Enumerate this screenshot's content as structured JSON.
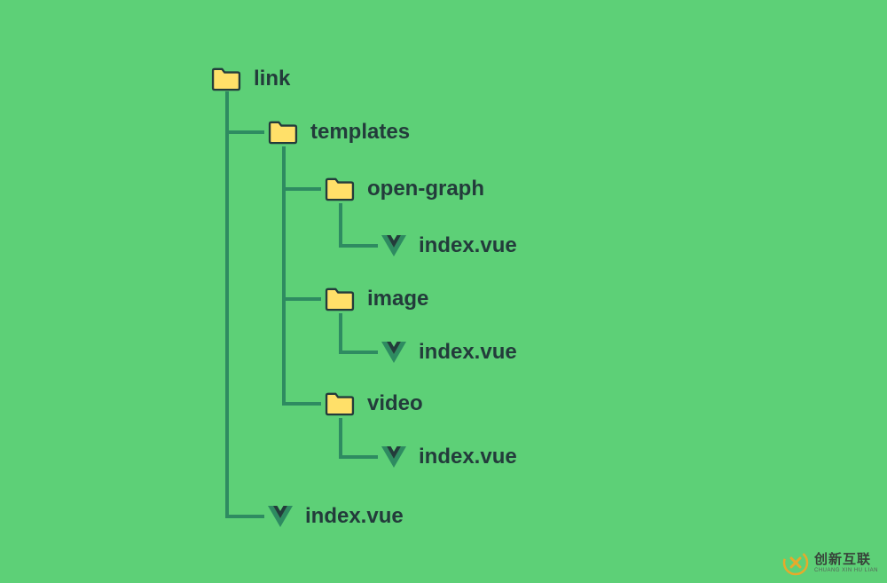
{
  "tree": {
    "root": {
      "type": "folder",
      "label": "link"
    },
    "templates": {
      "type": "folder",
      "label": "templates"
    },
    "open_graph": {
      "type": "folder",
      "label": "open-graph"
    },
    "open_graph_index": {
      "type": "vue",
      "label": "index.vue"
    },
    "image": {
      "type": "folder",
      "label": "image"
    },
    "image_index": {
      "type": "vue",
      "label": "index.vue"
    },
    "video": {
      "type": "folder",
      "label": "video"
    },
    "video_index": {
      "type": "vue",
      "label": "index.vue"
    },
    "root_index": {
      "type": "vue",
      "label": "index.vue"
    }
  },
  "watermark": {
    "cn": "创新互联",
    "en": "CHUANG XIN HU LIAN"
  },
  "colors": {
    "background": "#5dd077",
    "folder_fill": "#ffe069",
    "folder_stroke": "#233b3b",
    "vue_outer": "#2e8b61",
    "vue_inner": "#233b3b",
    "connector": "#2e8b61",
    "text": "#233b3b"
  }
}
